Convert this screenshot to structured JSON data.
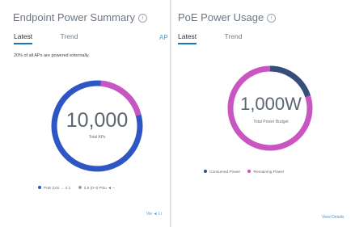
{
  "left_panel": {
    "title": "Endpoint Power Summary",
    "tabs": [
      {
        "label": "Latest"
      },
      {
        "label": "Trend"
      }
    ],
    "api_stub": "AP",
    "note": "20% of all APs are powered externally.",
    "donut": {
      "value": 10000,
      "display": "10,000",
      "label": "Total APs"
    },
    "legend": [
      {
        "label": "PoE (Uni → 4.1",
        "color": "#2f56c5"
      },
      {
        "label": "3.5 (0+0 PSu ◄ –",
        "color": "#9aa0a6"
      }
    ],
    "link": "Vie ◄ Li"
  },
  "right_panel": {
    "title": "PoE Power Usage",
    "tabs": [
      {
        "label": "Latest"
      },
      {
        "label": "Trend"
      }
    ],
    "donut": {
      "value": "1,000W",
      "label": "Total Power Budget"
    },
    "legend": [
      {
        "label": "Consumed Power",
        "color": "#34507a"
      },
      {
        "label": "Remaining Power",
        "color": "#d14fb7"
      }
    ],
    "link": "View Details"
  },
  "colors": {
    "blue_arc": "#2f56c5",
    "pink_arc": "#c855c0",
    "active_tab": "#1b75bb"
  }
}
